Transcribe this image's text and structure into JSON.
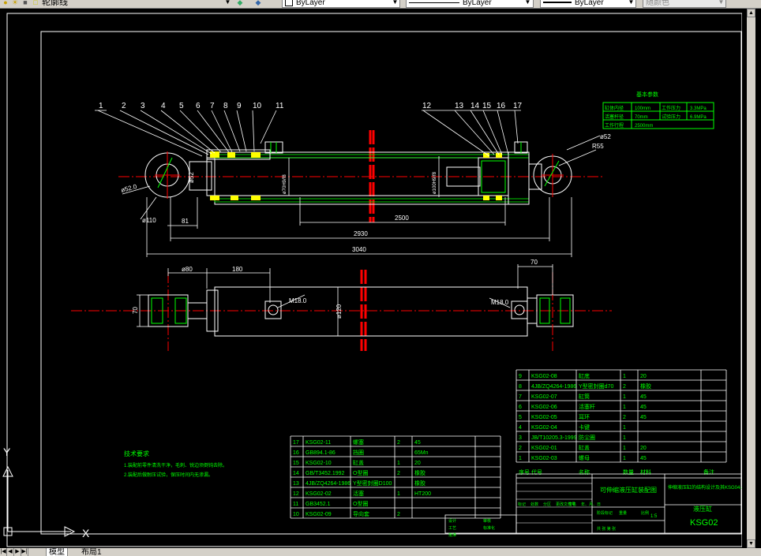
{
  "toolbar": {
    "layer_name": "轮廓线",
    "color_control": "ByLayer",
    "linetype_control": "ByLayer",
    "lineweight_control": "ByLayer",
    "plotstyle_control": "随颜色"
  },
  "tabs": {
    "model": "模型",
    "layout1": "布局1"
  },
  "ucs": {
    "x_label": "X",
    "y_label": "Y"
  },
  "drawing": {
    "part_numbers_top": [
      "1",
      "2",
      "3",
      "4",
      "5",
      "6",
      "7",
      "8",
      "9",
      "10",
      "11"
    ],
    "part_numbers_right": [
      "12",
      "13",
      "14",
      "15",
      "16",
      "17"
    ],
    "dims": {
      "d_52_left": "ø52.0",
      "d_110": "ø110",
      "d_52_v": "ø52",
      "len_81": "81",
      "len_2500": "2500",
      "len_2930": "2930",
      "len_3040": "3040",
      "phi_80": "ø80",
      "len_180": "180",
      "len_70": "70",
      "len_70_v": "70",
      "m18_left": "M18.0",
      "m18_right": "M18.0",
      "phi_120": "ø120",
      "phi_52_right": "ø52",
      "r55": "R55",
      "bore_1": "ø70H9/f8",
      "bore_2": "ø100H9/f8"
    },
    "params_title": "基本参数",
    "params_rows": [
      [
        "缸体内径",
        "100mm",
        "工作压力",
        "3.3MPa"
      ],
      [
        "活塞杆径",
        "70mm",
        "试验压力",
        "6.9MPa"
      ],
      [
        "工作行程",
        "2500mm",
        "",
        ""
      ]
    ],
    "notes_title": "技术要求",
    "notes_lines": [
      "1.装配前零件清洗干净，毛刺、锐边须倒钝去除。",
      "2.装配后做耐压试验，保压时间内无渗漏。"
    ]
  },
  "bom_left": [
    [
      "17",
      "KSG02-11",
      "螺塞",
      "2",
      "45",
      ""
    ],
    [
      "16",
      "GB894.1-86",
      "挡圈",
      "",
      "65Mn",
      ""
    ],
    [
      "15",
      "KSG02-10",
      "缸盖",
      "1",
      "20",
      ""
    ],
    [
      "14",
      "GB/T3452.1992",
      "O型圈",
      "2",
      "橡胶",
      ""
    ],
    [
      "13",
      "4JB/ZQ4264-1986",
      "Y型密封圈D100",
      "",
      "橡胶",
      ""
    ],
    [
      "12",
      "KSG02-02",
      "活塞",
      "1",
      "HT200",
      ""
    ],
    [
      "11",
      "GB3452.1",
      "O型圈",
      "",
      "",
      ""
    ],
    [
      "10",
      "KSG02-09",
      "导向套",
      "2",
      "",
      ""
    ]
  ],
  "bom_right": [
    [
      "9",
      "KSG02-08",
      "缸底",
      "1",
      "20",
      ""
    ],
    [
      "8",
      "4JB/ZQ4264-1986",
      "Y型密封圈d70",
      "2",
      "橡胶",
      ""
    ],
    [
      "7",
      "KSG02-07",
      "缸筒",
      "1",
      "45",
      ""
    ],
    [
      "6",
      "KSG02-06",
      "活塞杆",
      "1",
      "45",
      ""
    ],
    [
      "5",
      "KSG02-05",
      "耳环",
      "2",
      "45",
      ""
    ],
    [
      "4",
      "KSG02-04",
      "卡键",
      "1",
      "",
      ""
    ],
    [
      "3",
      "JB/T10205.3-1999",
      "防尘圈",
      "1",
      "",
      ""
    ],
    [
      "2",
      "KSG02-01",
      "缸盖",
      "1",
      "20",
      ""
    ],
    [
      "1",
      "KSG02-03",
      "螺母",
      "1",
      "45",
      ""
    ]
  ],
  "bom_header": [
    "序号",
    "代号",
    "名称",
    "数量",
    "材料",
    "备注"
  ],
  "title_block": {
    "part_name": "可伸缩液压缸装配图",
    "design_title": "伸缩液压缸的结构设计及其KSG04-2",
    "drawing_no": "KSG02",
    "sheet_label": "液压缸",
    "scale": "1:5",
    "sign_labels": [
      "标记",
      "处数",
      "分区",
      "更改文件号",
      "签名",
      "年、月、日"
    ],
    "role_labels": [
      "设计",
      "审核",
      "工艺",
      "标准化",
      "批准"
    ],
    "stage_labels": [
      "阶段标记",
      "重量",
      "比例"
    ],
    "sheet_info": "共 张 第 张"
  }
}
